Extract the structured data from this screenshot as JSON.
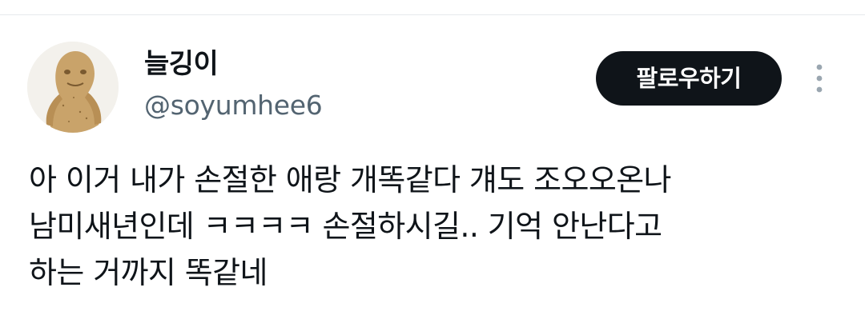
{
  "user": {
    "display_name": "늘깅이",
    "handle": "@soyumhee6",
    "avatar_icon": "clay-figure-avatar-icon"
  },
  "actions": {
    "follow_label": "팔로우하기",
    "more_icon": "more-vertical-icon"
  },
  "tweet": {
    "lines": [
      "아 이거 내가 손절한 애랑 개똑같다 걔도 조오오온나",
      "남미새년인데 ㅋㅋㅋㅋ 손절하시길.. 기억 안난다고",
      "하는 거까지 똑같네"
    ]
  },
  "colors": {
    "text_primary": "#0f1419",
    "text_secondary": "#536471",
    "button_bg": "#0f1419",
    "button_text": "#ffffff",
    "more_dots": "#9aa6b0"
  }
}
